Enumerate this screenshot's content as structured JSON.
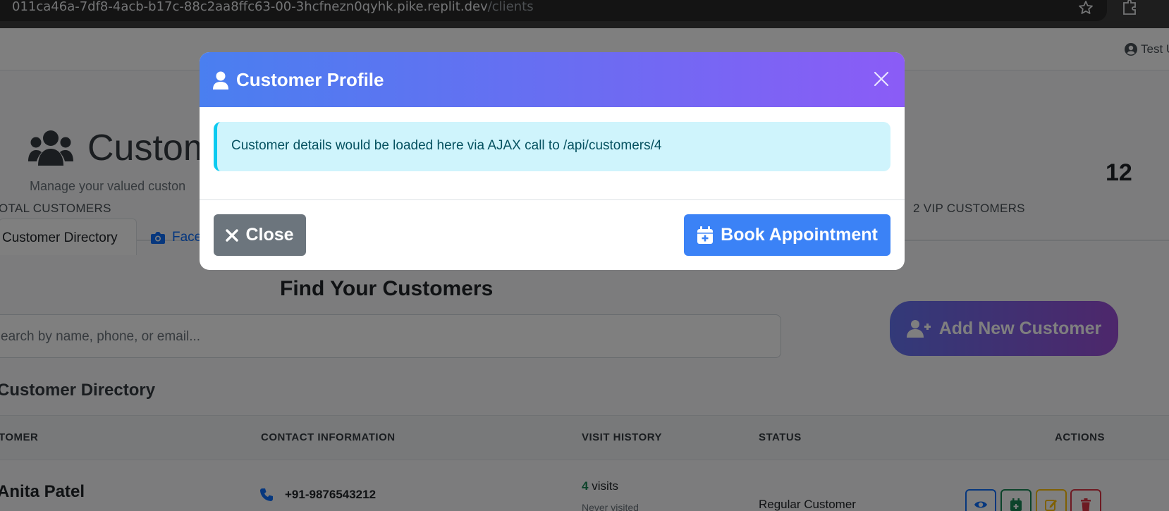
{
  "browser": {
    "url_host": "011ca46a-7df8-4acb-b17c-88c2aa8ffc63-00-3hcfnezn0qyhk.pike.replit.dev",
    "url_path": "/clients",
    "bookmark_icon": "star-outline-icon",
    "extensions_icon": "puzzle-piece-icon"
  },
  "navbar": {
    "user_label": "Test U",
    "user_icon": "user-circle-icon"
  },
  "hero": {
    "title": "Custom",
    "subtitle": "Manage your valued custon",
    "icon": "users-icon"
  },
  "stats": {
    "total_label": "OTAL CUSTOMERS",
    "vip_label": "2 VIP CUSTOMERS",
    "right_number": "12"
  },
  "tabs": {
    "active": "Customer Directory",
    "second": "Face",
    "second_icon": "camera-icon"
  },
  "search": {
    "title": "Find Your Customers",
    "placeholder": "earch by name, phone, or email...",
    "add_button": "Add New Customer",
    "add_icon": "user-plus-icon"
  },
  "directory": {
    "title": "Customer Directory",
    "columns": [
      "TOMER",
      "CONTACT INFORMATION",
      "VISIT HISTORY",
      "STATUS",
      "ACTIONS"
    ],
    "rows": [
      {
        "name": "Anita Patel",
        "phone": "+91-9876543212",
        "visits_count": "4",
        "visits_word": "visits",
        "last_visit": "Never visited",
        "status": "Regular Customer"
      }
    ],
    "action_icons": [
      "eye-icon",
      "calendar-plus-icon",
      "edit-icon",
      "trash-icon"
    ]
  },
  "modal": {
    "title": "Customer Profile",
    "title_icon": "user-icon",
    "alert_text": "Customer details would be loaded here via AJAX call to /api/customers/4",
    "close_label": "Close",
    "book_label": "Book Appointment",
    "book_icon": "calendar-plus-icon",
    "header_gradient": [
      "#4a7ff0",
      "#8b5cf6"
    ],
    "alert_color": "#cff4fc",
    "close_color": "#6c757d",
    "book_color": "#3b82f6"
  }
}
